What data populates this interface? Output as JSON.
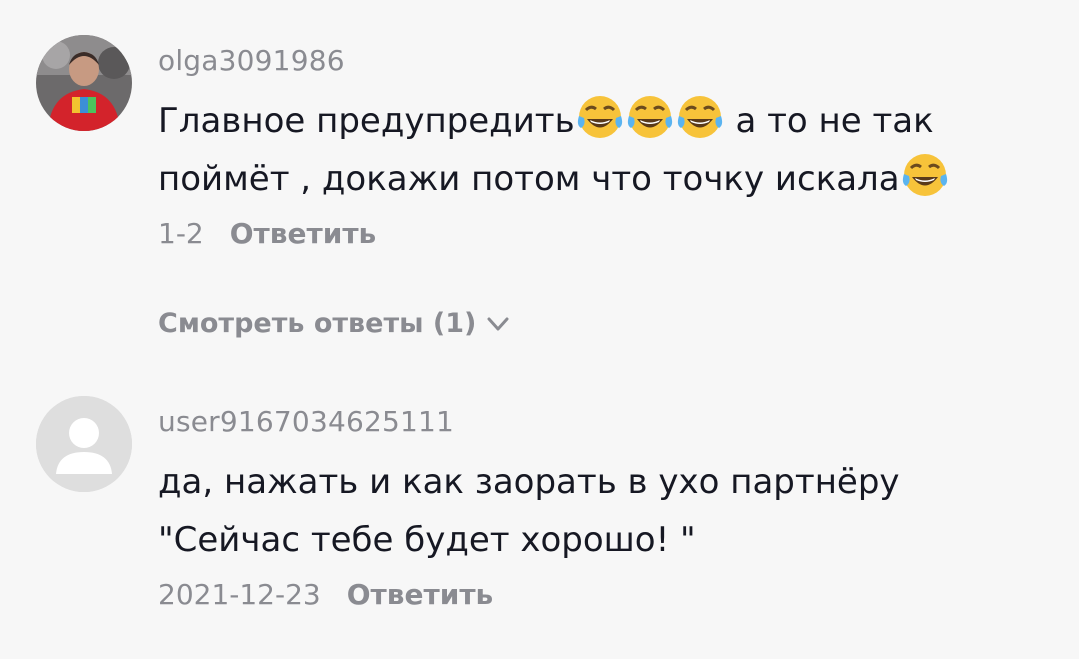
{
  "comments": [
    {
      "username": "olga3091986",
      "text_line1": "Главное предупредить",
      "text_line1_after": " а то не так",
      "text_line2": "поймёт , докажи потом что точку искала",
      "emoji_name": "face-with-tears-of-joy-icon",
      "date": "1-2",
      "reply_label": "Ответить",
      "view_replies_label": "Смотреть ответы (1)"
    },
    {
      "username": "user9167034625111",
      "text_line1": "да, нажать и как заорать в ухо партнёру",
      "text_line2": "\"Сейчас тебе будет хорошо! \"",
      "date": "2021-12-23",
      "reply_label": "Ответить"
    }
  ],
  "colors": {
    "background": "#f7f7f7",
    "username": "#8a8b91",
    "text": "#161823",
    "emoji": "#f7c33a"
  }
}
